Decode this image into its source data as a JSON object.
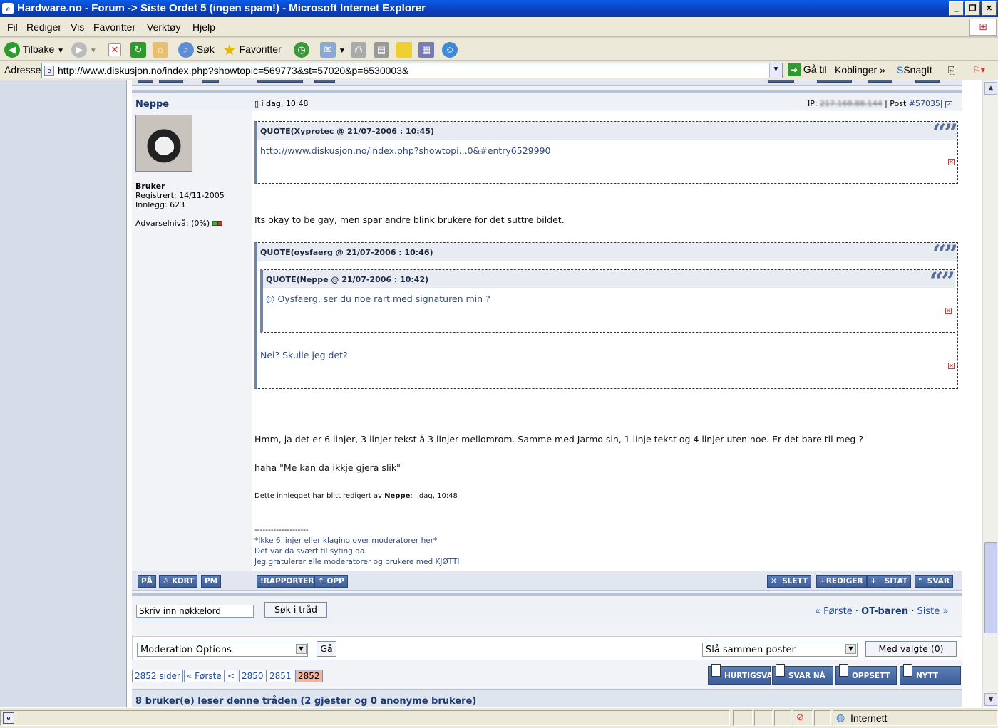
{
  "window": {
    "title": "Hardware.no - Forum -> Siste Ordet 5 (ingen spam!) - Microsoft Internet Explorer",
    "minimize": "_",
    "restore": "❐",
    "close": "✕"
  },
  "menu": [
    "Fil",
    "Rediger",
    "Vis",
    "Favoritter",
    "Verktøy",
    "Hjelp"
  ],
  "toolbar": {
    "back": "Tilbake",
    "search": "Søk",
    "favorites": "Favoritter"
  },
  "addressbar": {
    "label": "Adresse",
    "url": "http://www.diskusjon.no/index.php?showtopic=569773&st=57020&p=6530003&",
    "go": "Gå til",
    "links": "Koblinger",
    "snagit": "SnagIt"
  },
  "post": {
    "author": "Neppe",
    "date": "i dag, 10:48",
    "ip_label": "IP:",
    "ip_value": "217.168.88.144",
    "post_label": "| Post",
    "post_number": "#57035",
    "role": "Bruker",
    "registered": "Registrert: 14/11-2005",
    "posts": "Innlegg: 623",
    "warning": "Advarselnivå: (0%)",
    "quote1": {
      "header": "QUOTE(Xyprotec @ 21/07-2006 : 10:45)",
      "body": "http://www.diskusjon.no/index.php?showtopi...0&#entry6529990"
    },
    "text1": "Its okay to be gay, men spar andre blink brukere for det suttre bildet.",
    "quote2": {
      "header": "QUOTE(oysfaerg @ 21/07-2006 : 10:46)",
      "inner_header": "QUOTE(Neppe @ 21/07-2006 : 10:42)",
      "inner_body": "@ Oysfaerg, ser du noe rart med signaturen min ?",
      "body": "Nei? Skulle jeg det?"
    },
    "text2": "Hmm, ja det er 6 linjer, 3 linjer tekst å 3 linjer mellomrom. Samme med Jarmo sin, 1 linje tekst og 4 linjer uten noe. Er det bare til meg ?",
    "text3": "haha \"Me kan da ikkje gjera slik\"",
    "edited_prefix": "Dette innlegget har blitt redigert av",
    "edited_by": "Neppe",
    "edited_suffix": ": i dag, 10:48",
    "sig_sep": "--------------------",
    "sig": [
      "*Ikke 6 linjer eller klaging over moderatorer her*",
      "Det var da svært til syting da.",
      "Jeg gratulerer alle moderatorer og brukere med KJØTTI"
    ]
  },
  "buttons": {
    "pa": "PÅ",
    "kort": "KORT",
    "pm": "PM",
    "rapporter": "RAPPORTER",
    "opp": "OPP",
    "slett": "SLETT",
    "rediger": "REDIGER",
    "sitat": "SITAT",
    "svar": "SVAR"
  },
  "search": {
    "placeholder": "Skriv inn nøkkelord",
    "value": "Skriv inn nøkkelord",
    "button": "Søk i tråd"
  },
  "nav": {
    "first": "« Første",
    "dot": "·",
    "forum": "OT-baren",
    "last": "Siste »"
  },
  "moderation": {
    "select": "Moderation Options",
    "go": "Gå",
    "merge": "Slå sammen poster",
    "selected": "Med valgte (0)"
  },
  "pagination": {
    "total": "2852 sider",
    "first": "« Første",
    "prev": "<",
    "pages": [
      "2850",
      "2851",
      "2852"
    ]
  },
  "actions": {
    "quick": "HURTIGSVAR",
    "reply": "SVAR NÅ",
    "setup": "OPPSETT",
    "new": "NYTT EMNE"
  },
  "readers": "8 bruker(e) leser denne tråden (2 gjester og 0 anonyme brukere)",
  "status": {
    "zone": "Internett"
  },
  "colors": {
    "accent": "#1c3b72",
    "button": "#4a6ca6",
    "current_page": "#f4b39a"
  }
}
